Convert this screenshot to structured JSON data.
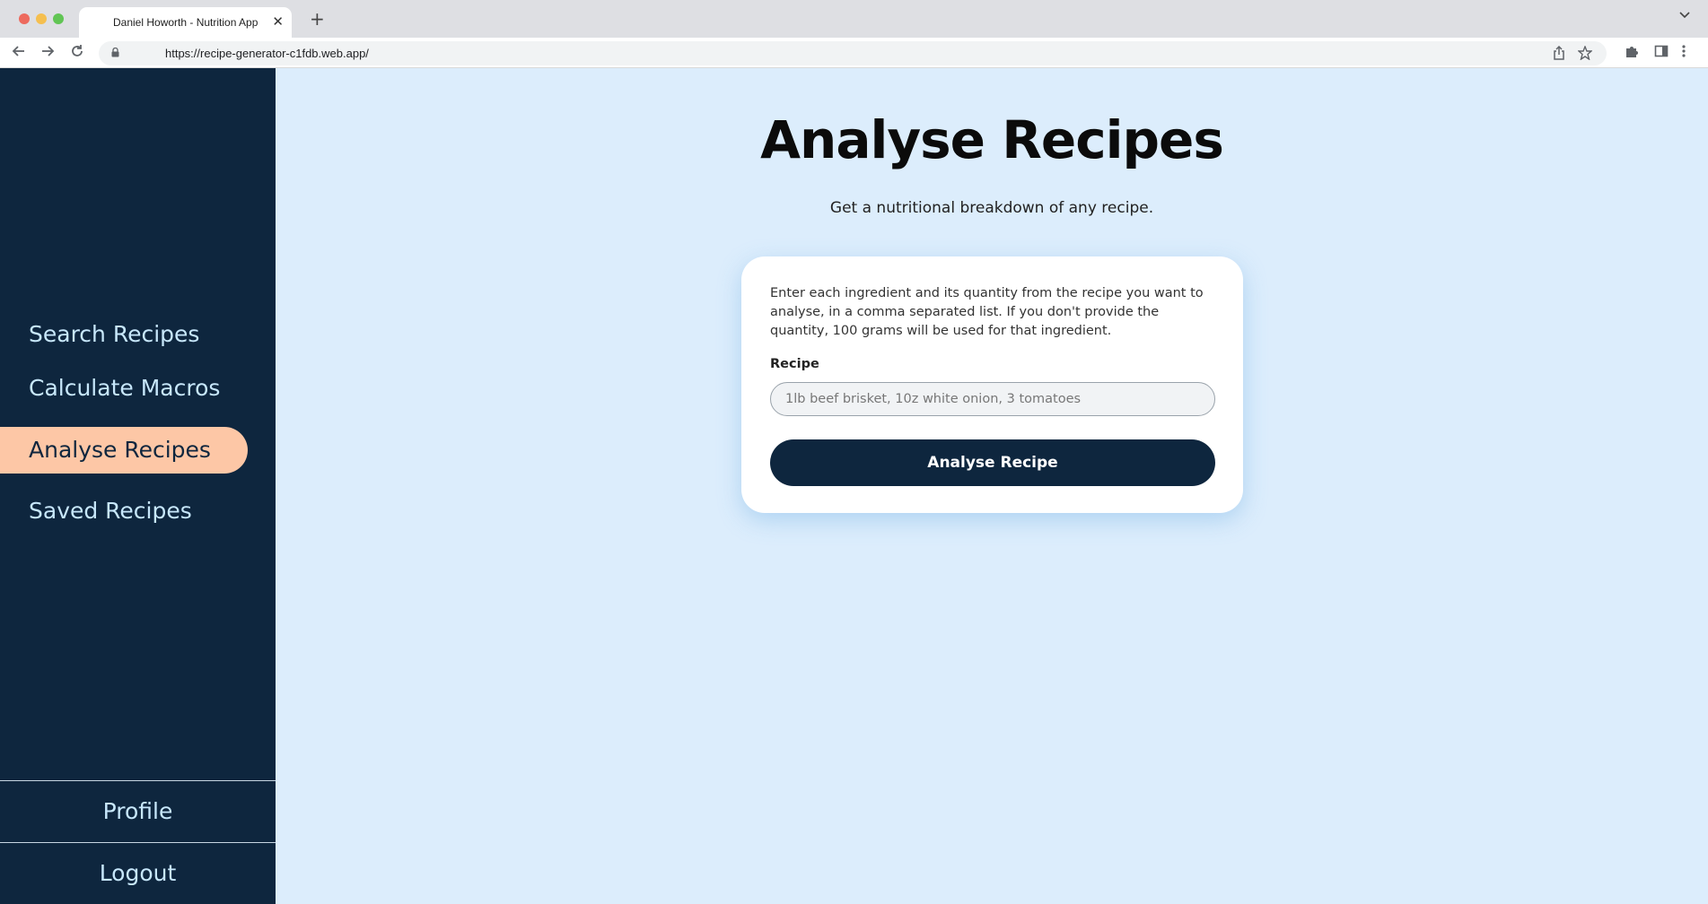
{
  "browser": {
    "tab_title": "Daniel Howorth - Nutrition App",
    "tab_close": "✕",
    "new_tab": "+",
    "url": "https://recipe-generator-c1fdb.web.app/"
  },
  "sidebar": {
    "items": [
      {
        "label": "Search Recipes",
        "active": false
      },
      {
        "label": "Calculate Macros",
        "active": false
      },
      {
        "label": "Analyse Recipes",
        "active": true
      },
      {
        "label": "Saved Recipes",
        "active": false
      }
    ],
    "profile_label": "Profile",
    "logout_label": "Logout"
  },
  "main": {
    "title": "Analyse Recipes",
    "subtitle": "Get a nutritional breakdown of any recipe.",
    "card": {
      "description": "Enter each ingredient and its quantity from the recipe you want to analyse, in a comma separated list. If you don't provide the quantity, 100 grams will be used for that ingredient.",
      "field_label": "Recipe",
      "input_value": "",
      "input_placeholder": "1lb beef brisket, 10z white onion, 3 tomatoes",
      "button_label": "Analyse Recipe"
    }
  },
  "colors": {
    "sidebar_bg": "#0e263e",
    "active_item_bg": "#fdc7a6",
    "main_bg": "#dcedfc",
    "button_bg": "#0e263e"
  }
}
